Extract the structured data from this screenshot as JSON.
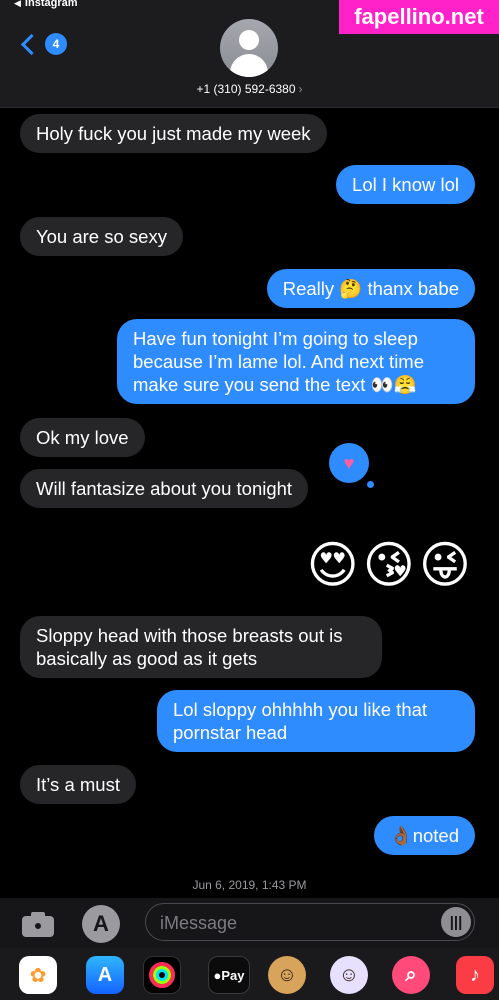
{
  "status": {
    "back_app": "Instagram"
  },
  "watermark": "fapellino.net",
  "header": {
    "unread_count": "4",
    "contact": "+1 (310) 592-6380"
  },
  "messages": [
    {
      "dir": "in",
      "text": "Holy fuck you just made my week"
    },
    {
      "dir": "out",
      "text": "Lol I know lol"
    },
    {
      "dir": "in",
      "text": "You are so sexy"
    },
    {
      "dir": "out",
      "text": "Really 🤔 thanx babe"
    },
    {
      "dir": "out",
      "text": "Have fun tonight I’m going to sleep because I’m lame lol. And next time make sure you send the text 👀😤"
    },
    {
      "dir": "in",
      "text": "Ok my love"
    },
    {
      "dir": "in",
      "text": "Will fantasize about you tonight"
    },
    {
      "dir": "in",
      "text": "Sloppy head with those breasts out is basically as good as it gets"
    },
    {
      "dir": "out",
      "text": "Lol sloppy ohhhhh you like that pornstar head"
    },
    {
      "dir": "in",
      "text": "It’s a must"
    },
    {
      "dir": "out",
      "text": "👌🏾noted"
    }
  ],
  "tapback": "♥",
  "emojis": "😍😘😜",
  "timestamp": "Jun 6, 2019, 1:43 PM",
  "input": {
    "placeholder": "iMessage"
  },
  "tray": {
    "apple_pay": "Pay"
  },
  "colors": {
    "outgoing": "#2f8cff",
    "incoming": "#262628",
    "watermark": "#ff22c8"
  },
  "icons": [
    "camera-icon",
    "app-store-icon",
    "voice-memo-icon",
    "photos-icon",
    "activity-icon",
    "apple-pay-icon",
    "memoji-icon",
    "search-images-icon",
    "music-icon"
  ]
}
